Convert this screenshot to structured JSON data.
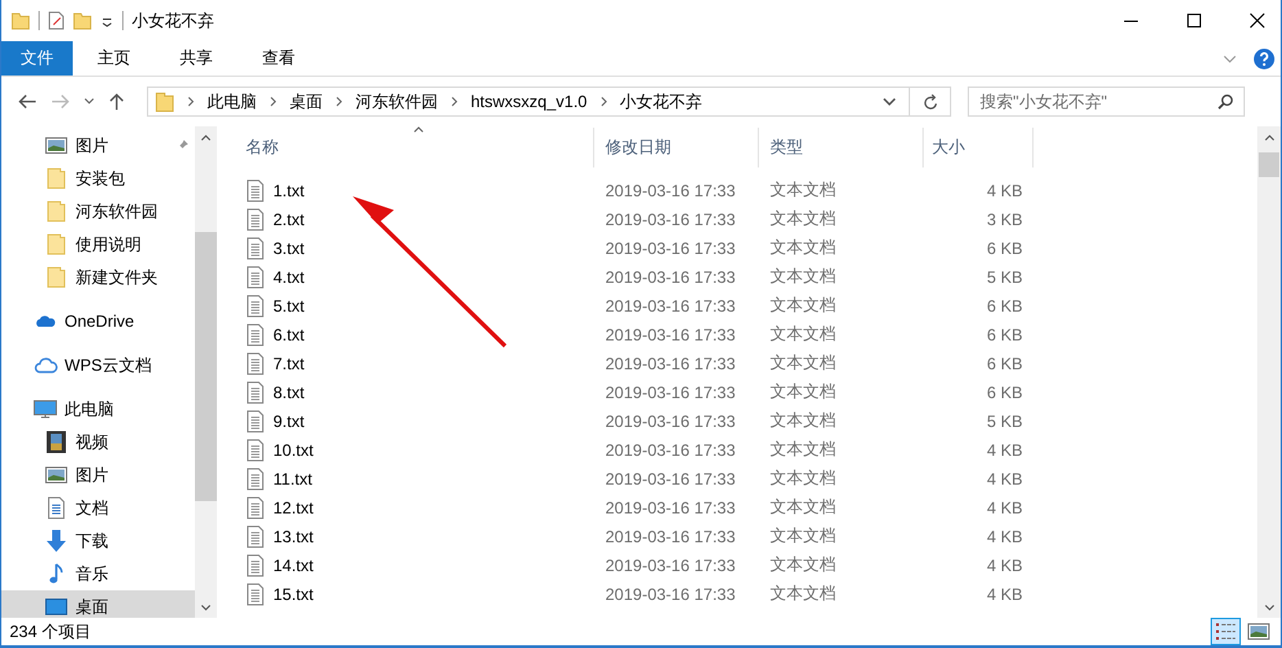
{
  "window": {
    "title": "小女花不弃"
  },
  "ribbon_tabs": [
    {
      "label": "文件",
      "kind": "file",
      "selected": false
    },
    {
      "label": "主页",
      "kind": "tab",
      "selected": false
    },
    {
      "label": "共享",
      "kind": "tab",
      "selected": false
    },
    {
      "label": "查看",
      "kind": "tab",
      "selected": false
    }
  ],
  "address": {
    "breadcrumbs": [
      "此电脑",
      "桌面",
      "河东软件园",
      "htswxsxzq_v1.0",
      "小女花不弃"
    ]
  },
  "search": {
    "placeholder": "搜索\"小女花不弃\""
  },
  "sidebar": {
    "quick_access": [
      {
        "label": "图片",
        "kind": "picture",
        "pinned": true,
        "selected": false
      },
      {
        "label": "安装包",
        "kind": "folder",
        "pinned": false,
        "selected": false
      },
      {
        "label": "河东软件园",
        "kind": "folder",
        "pinned": false,
        "selected": false
      },
      {
        "label": "使用说明",
        "kind": "folder",
        "pinned": false,
        "selected": false
      },
      {
        "label": "新建文件夹",
        "kind": "folder",
        "pinned": false,
        "selected": false
      }
    ],
    "roots": [
      {
        "label": "OneDrive",
        "kind": "onedrive",
        "selected": false
      },
      {
        "label": "WPS云文档",
        "kind": "cloud",
        "selected": false
      },
      {
        "label": "此电脑",
        "kind": "pc",
        "selected": false,
        "children": [
          {
            "label": "视频",
            "kind": "video",
            "selected": false
          },
          {
            "label": "图片",
            "kind": "picture",
            "selected": false
          },
          {
            "label": "文档",
            "kind": "document",
            "selected": false
          },
          {
            "label": "下载",
            "kind": "download",
            "selected": false
          },
          {
            "label": "音乐",
            "kind": "music",
            "selected": false
          },
          {
            "label": "桌面",
            "kind": "desktop",
            "selected": true
          }
        ]
      }
    ]
  },
  "table": {
    "columns": [
      {
        "label": "名称",
        "sorted": true
      },
      {
        "label": "修改日期",
        "sorted": false
      },
      {
        "label": "类型",
        "sorted": false
      },
      {
        "label": "大小",
        "sorted": false
      }
    ],
    "rows": [
      {
        "name": "1.txt",
        "modified": "2019-03-16 17:33",
        "type": "文本文档",
        "size": "4 KB"
      },
      {
        "name": "2.txt",
        "modified": "2019-03-16 17:33",
        "type": "文本文档",
        "size": "3 KB"
      },
      {
        "name": "3.txt",
        "modified": "2019-03-16 17:33",
        "type": "文本文档",
        "size": "6 KB"
      },
      {
        "name": "4.txt",
        "modified": "2019-03-16 17:33",
        "type": "文本文档",
        "size": "5 KB"
      },
      {
        "name": "5.txt",
        "modified": "2019-03-16 17:33",
        "type": "文本文档",
        "size": "6 KB"
      },
      {
        "name": "6.txt",
        "modified": "2019-03-16 17:33",
        "type": "文本文档",
        "size": "6 KB"
      },
      {
        "name": "7.txt",
        "modified": "2019-03-16 17:33",
        "type": "文本文档",
        "size": "6 KB"
      },
      {
        "name": "8.txt",
        "modified": "2019-03-16 17:33",
        "type": "文本文档",
        "size": "6 KB"
      },
      {
        "name": "9.txt",
        "modified": "2019-03-16 17:33",
        "type": "文本文档",
        "size": "5 KB"
      },
      {
        "name": "10.txt",
        "modified": "2019-03-16 17:33",
        "type": "文本文档",
        "size": "4 KB"
      },
      {
        "name": "11.txt",
        "modified": "2019-03-16 17:33",
        "type": "文本文档",
        "size": "4 KB"
      },
      {
        "name": "12.txt",
        "modified": "2019-03-16 17:33",
        "type": "文本文档",
        "size": "4 KB"
      },
      {
        "name": "13.txt",
        "modified": "2019-03-16 17:33",
        "type": "文本文档",
        "size": "4 KB"
      },
      {
        "name": "14.txt",
        "modified": "2019-03-16 17:33",
        "type": "文本文档",
        "size": "4 KB"
      },
      {
        "name": "15.txt",
        "modified": "2019-03-16 17:33",
        "type": "文本文档",
        "size": "4 KB"
      }
    ]
  },
  "status_bar": {
    "count": "234 个项目",
    "views": [
      {
        "kind": "details",
        "selected": true
      },
      {
        "kind": "large-icons",
        "selected": false
      }
    ]
  }
}
